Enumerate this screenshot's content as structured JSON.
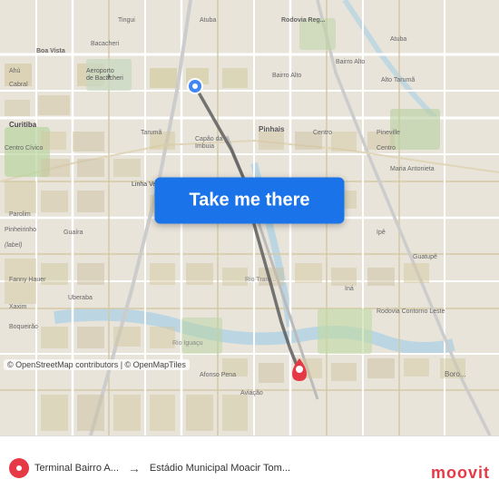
{
  "map": {
    "background_color": "#e8e0d8",
    "route_line_color": "#555555",
    "start_marker_color": "#4285F4",
    "end_marker_color": "#e63946"
  },
  "button": {
    "label": "Take me there",
    "bg_color": "#1a73e8",
    "text_color": "#ffffff"
  },
  "attribution": {
    "text": "© OpenStreetMap contributors | © OpenMapTiles"
  },
  "bottom_bar": {
    "from_label": "Terminal Bairro A...",
    "to_label": "Estádio Municipal Moacir Tom...",
    "moovit_label": "moovit"
  }
}
